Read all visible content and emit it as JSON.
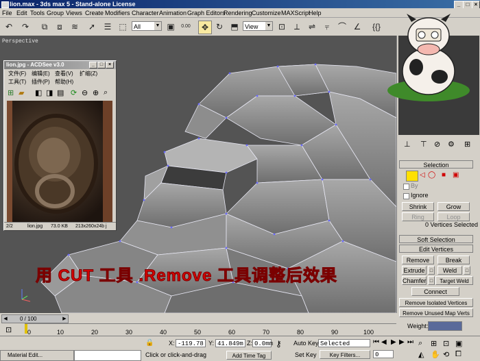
{
  "window": {
    "title": "lion.max - 3ds max 5 - Stand-alone License",
    "minimize": "_",
    "maximize": "□",
    "close": "×"
  },
  "menu": [
    "File",
    "Edit",
    "Tools",
    "Group",
    "Views",
    "Create",
    "Modifiers",
    "Character",
    "Animation",
    "Graph Editors",
    "Rendering",
    "Customize",
    "MAXScript",
    "Help"
  ],
  "toolbar": {
    "selection_filter": "All",
    "ref_coord": "View",
    "spinner_value": "0.00"
  },
  "viewport": {
    "label": "Perspective",
    "overlay_text": "用 CUT 工具 .Remove 工具调整后效果"
  },
  "acdsee": {
    "title": "lion.jpg - ACDSee v3.0",
    "menu_row1": [
      "文件(F)",
      "编辑(E)",
      "查看(V)",
      "扩缩(Z)"
    ],
    "menu_row2": [
      "工具(T)",
      "插件(P)",
      "帮助(H)"
    ],
    "status": {
      "index": "2/2",
      "filename": "lion.jpg",
      "size": "73.0 KB",
      "dims": "213x260x24b j"
    }
  },
  "panel": {
    "selection_header": "Selection",
    "by_label": "By",
    "ignore_label": "Ignore",
    "shrink": "Shrink",
    "grow": "Grow",
    "ring": "Ring",
    "loop": "Loop",
    "vertices_selected": "0 Vertices Selected",
    "soft_selection": "Soft Selection",
    "edit_vertices": "Edit Vertices",
    "remove": "Remove",
    "break": "Break",
    "extrude": "Extrude",
    "weld": "Weld",
    "chamfer": "Chamfer",
    "target_weld": "Target Weld",
    "connect": "Connect",
    "remove_isolated": "Remove Isolated Vertices",
    "remove_unused": "Remove Unused Map Verts",
    "weight_label": "Weight:"
  },
  "timeline": {
    "frame": "0 / 100"
  },
  "ruler_ticks": [
    "0",
    "10",
    "20",
    "30",
    "40",
    "50",
    "60",
    "70",
    "80",
    "90",
    "100"
  ],
  "status": {
    "material_editor": "Material Edit...",
    "x_label": "X:",
    "x_value": "-119.78",
    "y_label": "Y:",
    "y_value": "41.849m",
    "z_label": "Z:",
    "z_value": "0.0mm",
    "prompt": "Click or click-and-drag",
    "add_time_tag": "Add Time Tag",
    "auto_key": "Auto Key",
    "set_key": "Set Key",
    "selected": "Selected",
    "key_filters": "Key Filters...",
    "frame_field": "0"
  },
  "colors": {
    "viewport_bg": "#555555",
    "overlay_red": "#d40000",
    "active_yellow": "#ffe000"
  }
}
